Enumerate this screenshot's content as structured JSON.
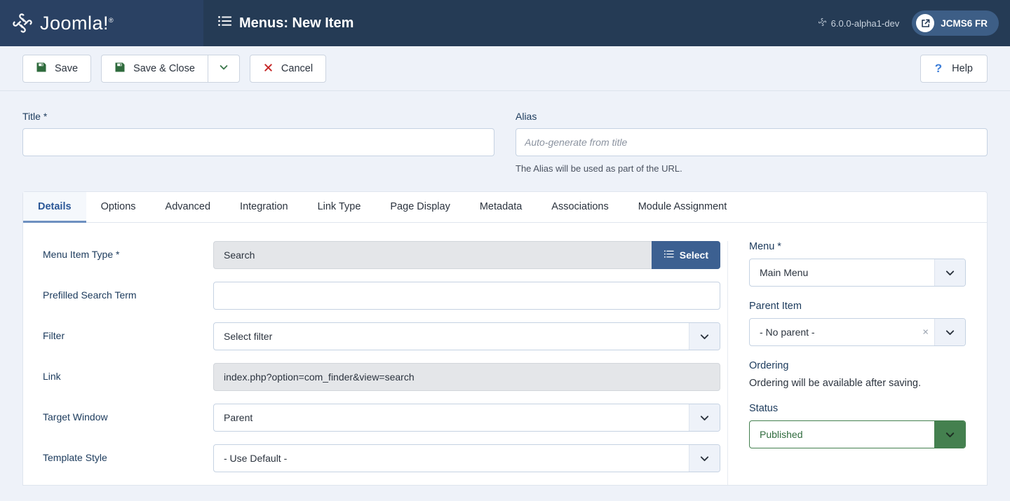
{
  "header": {
    "brand": "Joomla!",
    "brand_reg": "®",
    "page_title": "Menus: New Item",
    "page_title_icon": "list-icon",
    "version": "6.0.0-alpha1-dev",
    "version_icon": "joomla-icon",
    "site_link_label": "JCMS6 FR",
    "site_link_icon": "external-link-icon"
  },
  "toolbar": {
    "save_label": "Save",
    "save_icon": "floppy-disk-icon",
    "save_close_label": "Save & Close",
    "save_close_icon": "floppy-disk-icon",
    "dropdown_icon": "chevron-down-icon",
    "cancel_label": "Cancel",
    "cancel_icon": "close-x-icon",
    "help_label": "Help",
    "help_icon": "question-mark-icon"
  },
  "title_field": {
    "label": "Title *",
    "value": "",
    "placeholder": ""
  },
  "alias_field": {
    "label": "Alias",
    "value": "",
    "placeholder": "Auto-generate from title",
    "help": "The Alias will be used as part of the URL."
  },
  "tabs": [
    {
      "label": "Details",
      "active": true
    },
    {
      "label": "Options",
      "active": false
    },
    {
      "label": "Advanced",
      "active": false
    },
    {
      "label": "Integration",
      "active": false
    },
    {
      "label": "Link Type",
      "active": false
    },
    {
      "label": "Page Display",
      "active": false
    },
    {
      "label": "Metadata",
      "active": false
    },
    {
      "label": "Associations",
      "active": false
    },
    {
      "label": "Module Assignment",
      "active": false
    }
  ],
  "details": {
    "menu_item_type": {
      "label": "Menu Item Type *",
      "value": "Search",
      "select_button": "Select",
      "select_icon": "list-icon"
    },
    "prefilled_search_term": {
      "label": "Prefilled Search Term",
      "value": ""
    },
    "filter": {
      "label": "Filter",
      "value": "Select filter",
      "icon": "chevron-down-icon"
    },
    "link": {
      "label": "Link",
      "value": "index.php?option=com_finder&view=search"
    },
    "target_window": {
      "label": "Target Window",
      "value": "Parent",
      "icon": "chevron-down-icon"
    },
    "template_style": {
      "label": "Template Style",
      "value": "- Use Default -",
      "icon": "chevron-down-icon"
    }
  },
  "sidebar": {
    "menu": {
      "label": "Menu *",
      "value": "Main Menu",
      "icon": "chevron-down-icon"
    },
    "parent_item": {
      "label": "Parent Item",
      "value": "- No parent -",
      "clear_icon": "close-x-icon",
      "icon": "chevron-down-icon"
    },
    "ordering": {
      "label": "Ordering",
      "text": "Ordering will be available after saving."
    },
    "status": {
      "label": "Status",
      "value": "Published",
      "icon": "chevron-down-icon"
    }
  },
  "colors": {
    "header_logo_bg": "#2a4163",
    "header_bar_bg": "#253b55",
    "page_bg": "#eef2f9",
    "accent_blue": "#3c6091",
    "status_green": "#44804f",
    "danger_red": "#c62828",
    "save_icon_green": "#2f6b3d",
    "tab_active_blue": "#2b5797"
  }
}
